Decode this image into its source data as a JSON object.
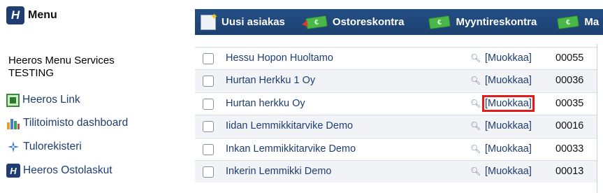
{
  "sidebar": {
    "title": "Menu",
    "logo_letter": "H",
    "org_line1": "Heeros Menu Services",
    "org_line2": "TESTING",
    "items": [
      {
        "label": "Heeros Link",
        "icon": "link-icon"
      },
      {
        "label": "Tilitoimisto dashboard",
        "icon": "dashboard-icon"
      },
      {
        "label": "Tulorekisteri",
        "icon": "star-icon"
      },
      {
        "label": "Heeros Ostolaskut",
        "icon": "heeros-icon",
        "icon_letter": "H"
      }
    ]
  },
  "toolbar": {
    "buttons": [
      {
        "label": "Uusi asiakas",
        "icon": "new-customer-icon"
      },
      {
        "label": "Ostoreskontra",
        "icon": "money-out-icon"
      },
      {
        "label": "Myyntireskontra",
        "icon": "money-in-icon"
      },
      {
        "label": "Ma",
        "icon": "money-icon"
      }
    ]
  },
  "customers": {
    "rows": [
      {
        "name": "Hessu Hopon Huoltamo",
        "edit": "[Muokkaa]",
        "number": "00055"
      },
      {
        "name": "Hurtan Herkku 1 Oy",
        "edit": "[Muokkaa]",
        "number": "00036"
      },
      {
        "name": "Hurtan herkku Oy",
        "edit": "[Muokkaa]",
        "number": "00035",
        "highlighted": true
      },
      {
        "name": "Iidan Lemmikkitarvike Demo",
        "edit": "[Muokkaa]",
        "number": "00016"
      },
      {
        "name": "Inkan Lemmikkitarvike Demo",
        "edit": "[Muokkaa]",
        "number": "00033"
      },
      {
        "name": "Inkerin Lemmikki Demo",
        "edit": "[Muokkaa]",
        "number": "00013"
      }
    ]
  },
  "colors": {
    "toolbar_bg": "#1d416f",
    "link": "#1e3d70",
    "highlight": "#e21b1b"
  }
}
